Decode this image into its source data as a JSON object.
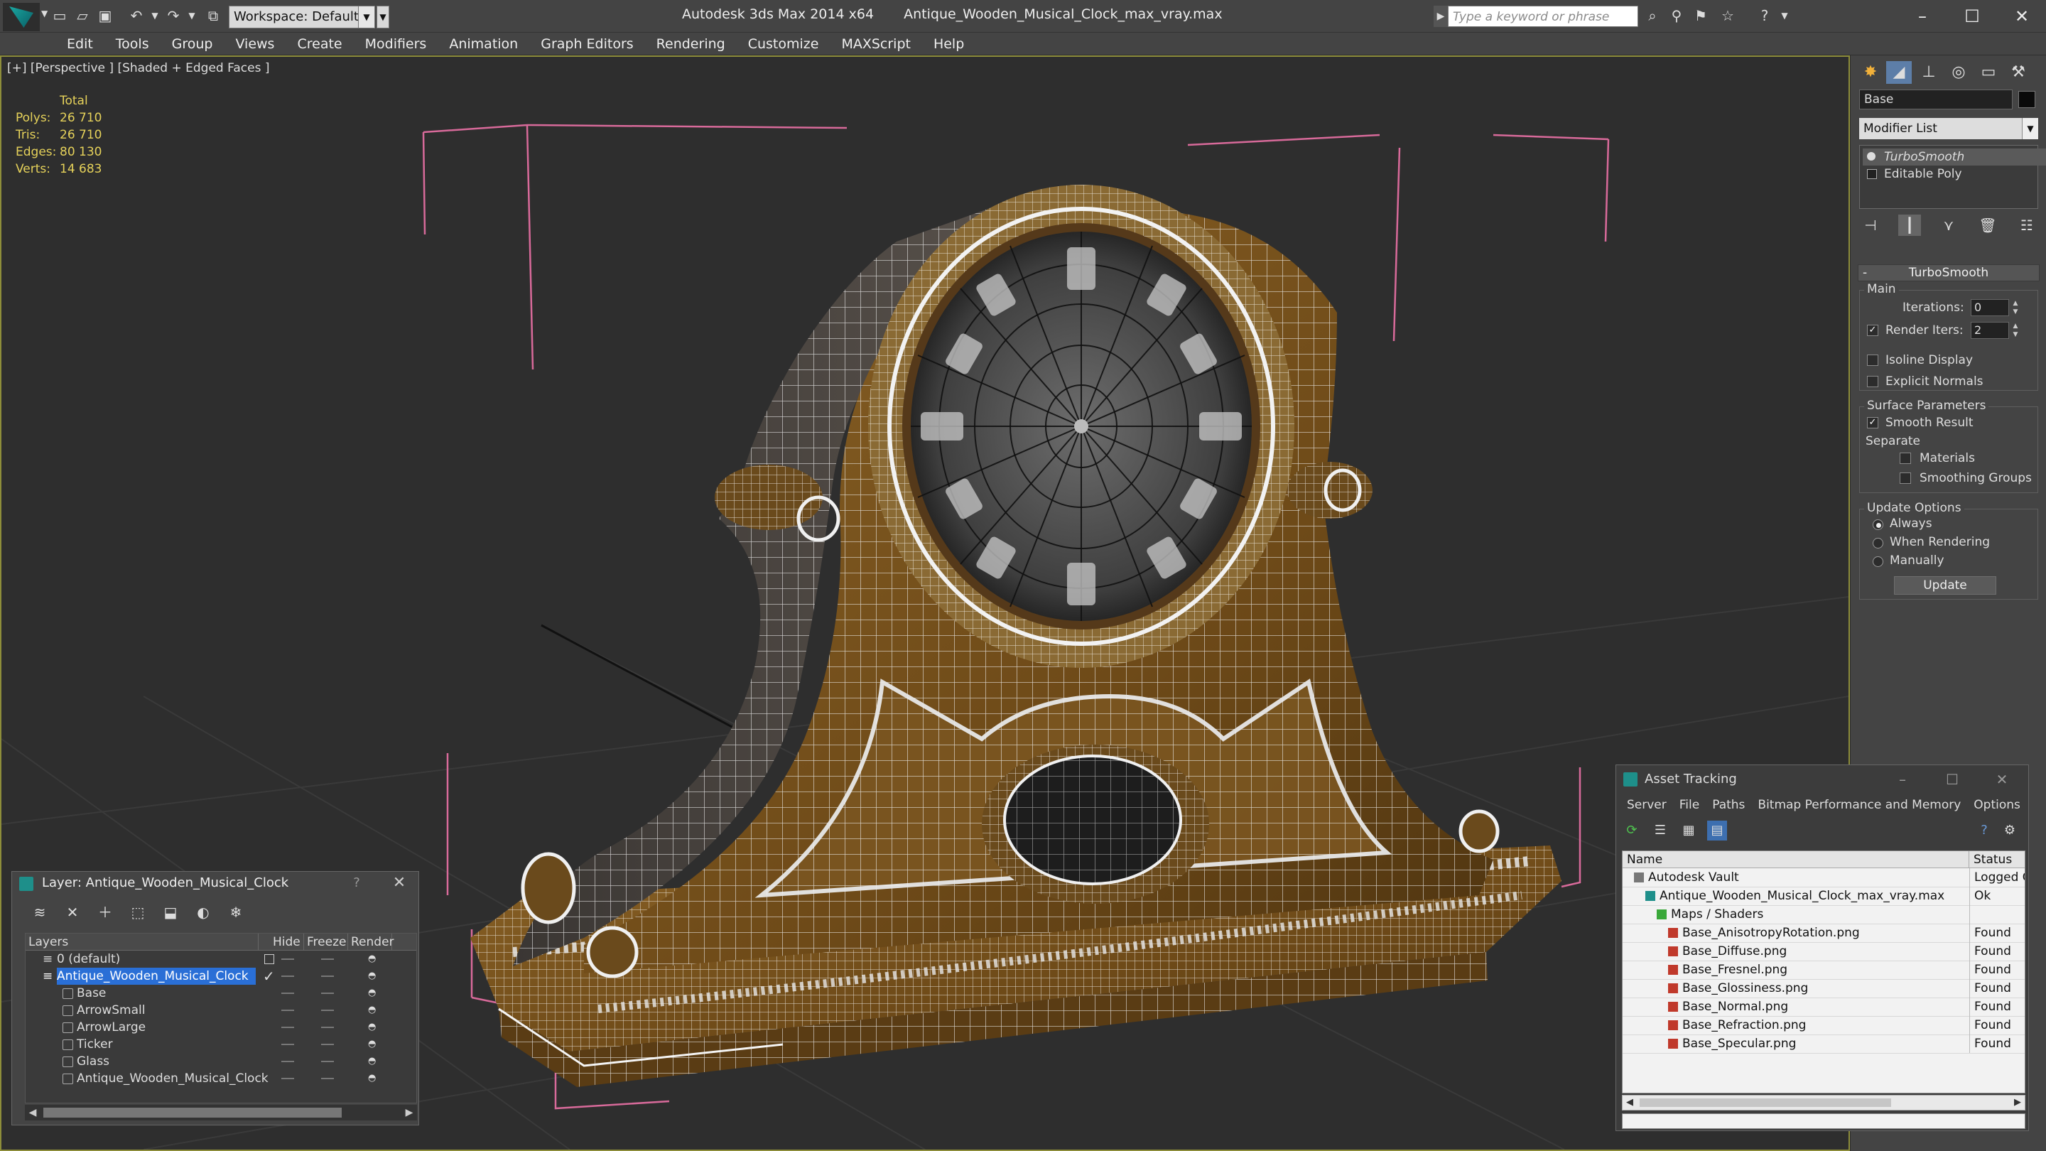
{
  "titlebar": {
    "workspace": "Workspace: Default",
    "app_name": "Autodesk 3ds Max  2014 x64",
    "file_name": "Antique_Wooden_Musical_Clock_max_vray.max",
    "search_placeholder": "Type a keyword or phrase"
  },
  "menu": [
    "Edit",
    "Tools",
    "Group",
    "Views",
    "Create",
    "Modifiers",
    "Animation",
    "Graph Editors",
    "Rendering",
    "Customize",
    "MAXScript",
    "Help"
  ],
  "viewport": {
    "label": "[+] [Perspective ] [Shaded + Edged Faces ]",
    "stats": {
      "header": "Total",
      "rows": [
        {
          "key": "Polys:",
          "value": "26 710"
        },
        {
          "key": "Tris:",
          "value": "26 710"
        },
        {
          "key": "Edges:",
          "value": "80 130"
        },
        {
          "key": "Verts:",
          "value": "14 683"
        }
      ]
    },
    "colors": {
      "selection_bracket": "#d86a9a",
      "wire": "#ffffff",
      "wood": "#7a5520",
      "grid": "#3c3c3c"
    }
  },
  "command_panel": {
    "object_name": "Base",
    "modifier_list": "Modifier List",
    "stack": [
      "TurboSmooth",
      "Editable Poly"
    ],
    "rollout": "TurboSmooth",
    "main": {
      "title": "Main",
      "iterations_label": "Iterations:",
      "iterations_value": "0",
      "render_iters_label": "Render Iters:",
      "render_iters_value": "2",
      "isoline_label": "Isoline Display",
      "explicit_normals_label": "Explicit Normals"
    },
    "surface": {
      "title": "Surface Parameters",
      "smooth_result_label": "Smooth Result",
      "separate_label": "Separate",
      "materials_label": "Materials",
      "smoothing_groups_label": "Smoothing Groups"
    },
    "update": {
      "title": "Update Options",
      "always": "Always",
      "when_rendering": "When Rendering",
      "manually": "Manually",
      "button": "Update"
    }
  },
  "layer_window": {
    "title": "Layer: Antique_Wooden_Musical_Clock",
    "help": "?",
    "columns": {
      "layers": "Layers",
      "hide": "Hide",
      "freeze": "Freeze",
      "render": "Render"
    },
    "rows": [
      {
        "name": "0 (default)",
        "level": 0,
        "type": "layer"
      },
      {
        "name": "Antique_Wooden_Musical_Clock",
        "level": 0,
        "type": "layer",
        "selected": true
      },
      {
        "name": "Base",
        "level": 1,
        "type": "object"
      },
      {
        "name": "ArrowSmall",
        "level": 1,
        "type": "object"
      },
      {
        "name": "ArrowLarge",
        "level": 1,
        "type": "object"
      },
      {
        "name": "Ticker",
        "level": 1,
        "type": "object"
      },
      {
        "name": "Glass",
        "level": 1,
        "type": "object"
      },
      {
        "name": "Antique_Wooden_Musical_Clock",
        "level": 1,
        "type": "object"
      }
    ]
  },
  "asset_window": {
    "title": "Asset Tracking",
    "menu": [
      "Server",
      "File",
      "Paths",
      "Bitmap Performance and Memory",
      "Options"
    ],
    "columns": {
      "name": "Name",
      "status": "Status"
    },
    "rows": [
      {
        "name": "Autodesk Vault",
        "level": 0,
        "status": "Logged O",
        "icon": "vault-icon"
      },
      {
        "name": "Antique_Wooden_Musical_Clock_max_vray.max",
        "level": 1,
        "status": "Ok",
        "icon": "max-file-icon"
      },
      {
        "name": "Maps / Shaders",
        "level": 2,
        "status": "",
        "icon": "maps-icon"
      },
      {
        "name": "Base_AnisotropyRotation.png",
        "level": 3,
        "status": "Found",
        "icon": "png-icon"
      },
      {
        "name": "Base_Diffuse.png",
        "level": 3,
        "status": "Found",
        "icon": "png-icon"
      },
      {
        "name": "Base_Fresnel.png",
        "level": 3,
        "status": "Found",
        "icon": "png-icon"
      },
      {
        "name": "Base_Glossiness.png",
        "level": 3,
        "status": "Found",
        "icon": "png-icon"
      },
      {
        "name": "Base_Normal.png",
        "level": 3,
        "status": "Found",
        "icon": "png-icon"
      },
      {
        "name": "Base_Refraction.png",
        "level": 3,
        "status": "Found",
        "icon": "png-icon"
      },
      {
        "name": "Base_Specular.png",
        "level": 3,
        "status": "Found",
        "icon": "png-icon"
      }
    ]
  }
}
